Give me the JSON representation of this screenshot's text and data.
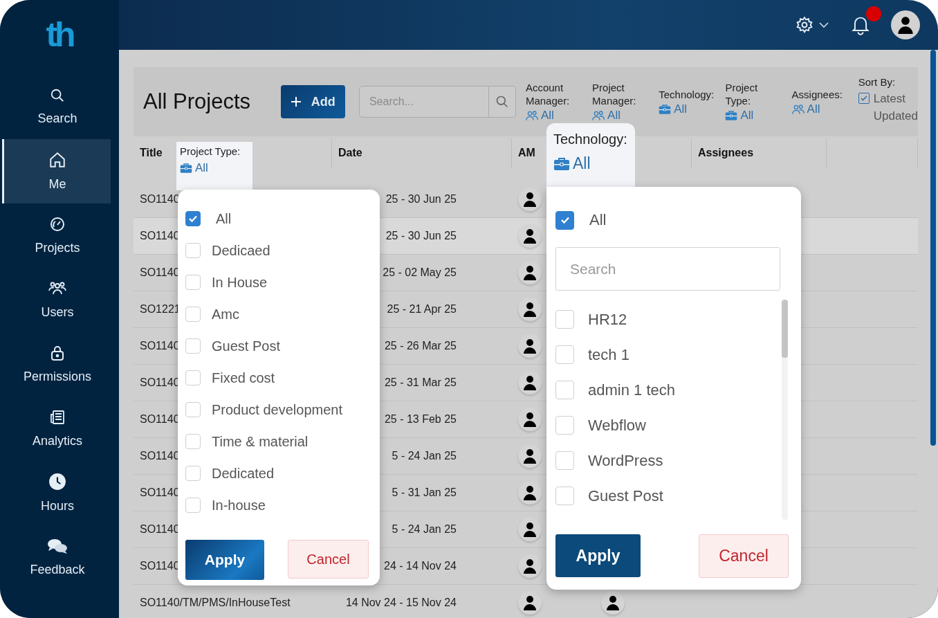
{
  "logo": "th",
  "sidebar": {
    "items": [
      {
        "label": "Search",
        "selected": false
      },
      {
        "label": "Me",
        "selected": true
      },
      {
        "label": "Projects",
        "selected": false
      },
      {
        "label": "Users",
        "selected": false
      },
      {
        "label": "Permissions",
        "selected": false
      },
      {
        "label": "Analytics",
        "selected": false
      },
      {
        "label": "Hours",
        "selected": false
      },
      {
        "label": "Feedback",
        "selected": false
      }
    ]
  },
  "topbar": {
    "unread_notifications": true
  },
  "toolbar": {
    "title": "All Projects",
    "add_button": "Add",
    "search": {
      "placeholder": "Search..."
    },
    "filters": [
      {
        "label": "Account Manager:",
        "value": "All",
        "kind": "people"
      },
      {
        "label": "Project Manager:",
        "value": "All",
        "kind": "people"
      },
      {
        "label": "Technology:",
        "value": "All",
        "kind": "category"
      },
      {
        "label": "Project Type:",
        "value": "All",
        "kind": "category"
      },
      {
        "label": "Assignees:",
        "value": "All",
        "kind": "people"
      }
    ],
    "sort": {
      "label": "Sort By:",
      "value": "Latest Updated",
      "checked": true
    }
  },
  "table": {
    "columns": [
      {
        "kind": "title",
        "label": "Title"
      },
      {
        "kind": "date",
        "label": "Date"
      },
      {
        "kind": "am",
        "label": "AM"
      },
      {
        "kind": "assignees",
        "label": "Assignees"
      }
    ],
    "rows": [
      {
        "title": "SO1140",
        "date": "25 - 30 Jun 25",
        "highlighted": false,
        "am": true,
        "pm": false
      },
      {
        "title": "SO1140",
        "date": "25 - 30 Jun 25",
        "highlighted": true,
        "am": true,
        "pm": false
      },
      {
        "title": "SO1140",
        "date": "25 - 02 May 25",
        "highlighted": false,
        "am": true,
        "pm": false
      },
      {
        "title": "SO1221",
        "date": "25 - 21 Apr 25",
        "highlighted": false,
        "am": true,
        "pm": false
      },
      {
        "title": "SO1140",
        "date": "25 - 26 Mar 25",
        "highlighted": false,
        "am": true,
        "pm": false
      },
      {
        "title": "SO1140",
        "date": "25 - 31 Mar 25",
        "highlighted": false,
        "am": true,
        "pm": false
      },
      {
        "title": "SO1140",
        "date": "25 - 13 Feb 25",
        "highlighted": false,
        "am": true,
        "pm": false
      },
      {
        "title": "SO1140",
        "date": "5 - 24 Jan 25",
        "highlighted": false,
        "am": true,
        "pm": false
      },
      {
        "title": "SO1140",
        "date": "5 - 31 Jan 25",
        "highlighted": false,
        "am": true,
        "pm": false
      },
      {
        "title": "SO1140",
        "date": "5 - 24 Jan 25",
        "highlighted": false,
        "am": true,
        "pm": false
      },
      {
        "title": "SO1140",
        "date": "24 - 14 Nov 24",
        "highlighted": false,
        "am": true,
        "pm": false
      },
      {
        "title": "SO1140/TM/PMS/InHouseTest",
        "date": "14 Nov 24 - 15 Nov 24",
        "highlighted": false,
        "am": true,
        "pm": true
      }
    ]
  },
  "project_type_popover": {
    "label": "Project Type:",
    "value": "All",
    "options": [
      {
        "label": "All",
        "checked": true
      },
      {
        "label": "Dedicaed",
        "checked": false
      },
      {
        "label": "In House",
        "checked": false
      },
      {
        "label": "Amc",
        "checked": false
      },
      {
        "label": "Guest Post",
        "checked": false
      },
      {
        "label": "Fixed cost",
        "checked": false
      },
      {
        "label": "Product development",
        "checked": false
      },
      {
        "label": "Time & material",
        "checked": false
      },
      {
        "label": "Dedicated",
        "checked": false
      },
      {
        "label": "In-house",
        "checked": false
      }
    ],
    "apply": "Apply",
    "cancel": "Cancel"
  },
  "technology_popover": {
    "label": "Technology:",
    "value": "All",
    "all": {
      "label": "All",
      "checked": true
    },
    "search": {
      "placeholder": "Search"
    },
    "options": [
      {
        "label": "HR12",
        "checked": false
      },
      {
        "label": "tech 1",
        "checked": false
      },
      {
        "label": "admin 1 tech",
        "checked": false
      },
      {
        "label": "Webflow",
        "checked": false
      },
      {
        "label": "WordPress",
        "checked": false
      },
      {
        "label": "Guest Post",
        "checked": false
      }
    ],
    "apply": "Apply",
    "cancel": "Cancel"
  }
}
